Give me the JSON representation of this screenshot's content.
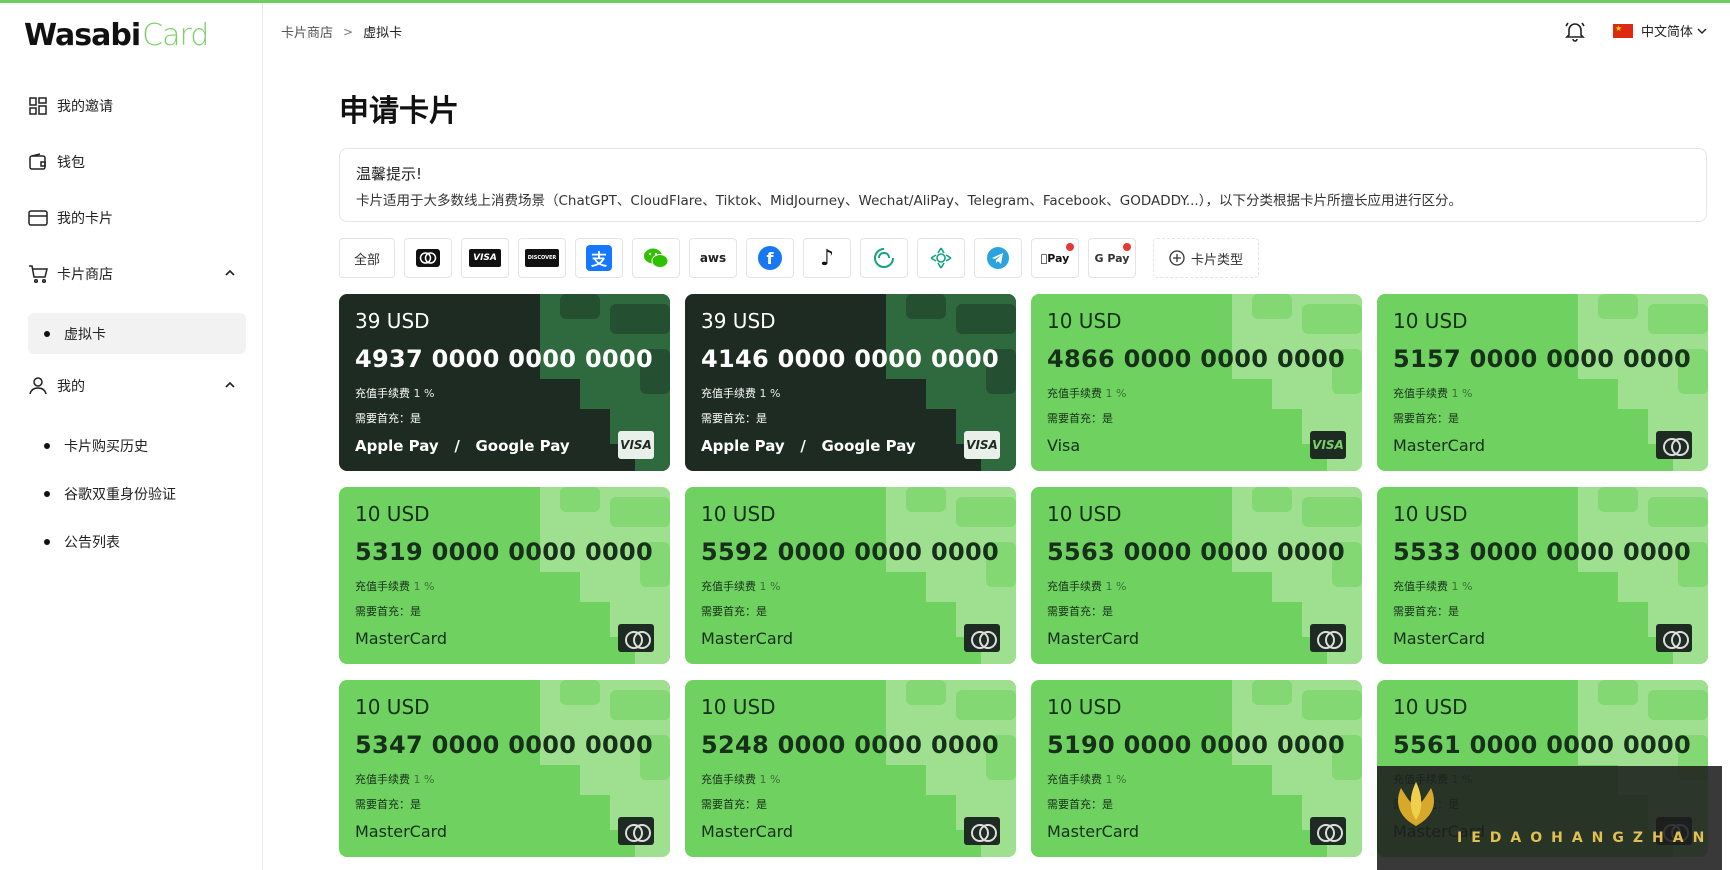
{
  "brand": {
    "part1": "Wasabi",
    "part2": "Card"
  },
  "sidebar": {
    "items": [
      {
        "label": "我的邀请",
        "icon": "grid-icon"
      },
      {
        "label": "钱包",
        "icon": "wallet-icon"
      },
      {
        "label": "我的卡片",
        "icon": "credit-card-icon"
      },
      {
        "label": "卡片商店",
        "icon": "cart-icon"
      },
      {
        "label": "我的",
        "icon": "user-icon"
      }
    ],
    "store_sub": [
      {
        "label": "虚拟卡"
      }
    ],
    "mine_sub": [
      {
        "label": "卡片购买历史"
      },
      {
        "label": "谷歌双重身份验证"
      },
      {
        "label": "公告列表"
      }
    ]
  },
  "header": {
    "breadcrumb": [
      "卡片商店",
      "虚拟卡"
    ],
    "breadcrumb_sep": ">",
    "language": "中文简体"
  },
  "page": {
    "title": "申请卡片",
    "notice_title": "温馨提示!",
    "notice_body": "卡片适用于大多数线上消费场景（ChatGPT、CloudFlare、Tiktok、MidJourney、Wechat/AliPay、Telegram、Facebook、GODADDY...），以下分类根据卡片所擅长应用进行区分。"
  },
  "filters": {
    "all": "全部",
    "chips": [
      {
        "name": "mastercard",
        "text": ""
      },
      {
        "name": "visa",
        "text": "VISA"
      },
      {
        "name": "discover",
        "text": "DISCOVER"
      },
      {
        "name": "alipay",
        "text": "支"
      },
      {
        "name": "wechat",
        "text": ""
      },
      {
        "name": "aws",
        "text": "aws"
      },
      {
        "name": "facebook",
        "text": "f"
      },
      {
        "name": "tiktok",
        "text": "♪"
      },
      {
        "name": "cloud",
        "text": ""
      },
      {
        "name": "openai",
        "text": ""
      },
      {
        "name": "telegram",
        "text": ""
      },
      {
        "name": "apple-pay",
        "text": "Pay"
      },
      {
        "name": "google-pay",
        "text": "G Pay"
      }
    ],
    "type_label": "卡片类型"
  },
  "cards": [
    {
      "amount": "39 USD",
      "number": "4937 0000 0000 0000",
      "fee_label": "充值手续费",
      "fee": "1 %",
      "req": "需要首充：是",
      "brand": "Apple Pay   /   Google Pay",
      "badge": "VISA",
      "style": "dark"
    },
    {
      "amount": "39 USD",
      "number": "4146 0000 0000 0000",
      "fee_label": "充值手续费",
      "fee": "1 %",
      "req": "需要首充：是",
      "brand": "Apple Pay   /   Google Pay",
      "badge": "VISA",
      "style": "dark"
    },
    {
      "amount": "10 USD",
      "number": "4866 0000 0000 0000",
      "fee_label": "充值手续费",
      "fee": "1 %",
      "req": "需要首充：是",
      "brand": "Visa",
      "badge": "VISA",
      "style": "green"
    },
    {
      "amount": "10 USD",
      "number": "5157 0000 0000 0000",
      "fee_label": "充值手续费",
      "fee": "1 %",
      "req": "需要首充：是",
      "brand": "MasterCard",
      "badge": "mc",
      "style": "green"
    },
    {
      "amount": "10 USD",
      "number": "5319 0000 0000 0000",
      "fee_label": "充值手续费",
      "fee": "1 %",
      "req": "需要首充：是",
      "brand": "MasterCard",
      "badge": "mc",
      "style": "green"
    },
    {
      "amount": "10 USD",
      "number": "5592 0000 0000 0000",
      "fee_label": "充值手续费",
      "fee": "1 %",
      "req": "需要首充：是",
      "brand": "MasterCard",
      "badge": "mc",
      "style": "green"
    },
    {
      "amount": "10 USD",
      "number": "5563 0000 0000 0000",
      "fee_label": "充值手续费",
      "fee": "1 %",
      "req": "需要首充：是",
      "brand": "MasterCard",
      "badge": "mc",
      "style": "green"
    },
    {
      "amount": "10 USD",
      "number": "5533 0000 0000 0000",
      "fee_label": "充值手续费",
      "fee": "1 %",
      "req": "需要首充：是",
      "brand": "MasterCard",
      "badge": "mc",
      "style": "green"
    },
    {
      "amount": "10 USD",
      "number": "5347 0000 0000 0000",
      "fee_label": "充值手续费",
      "fee": "1 %",
      "req": "需要首充：是",
      "brand": "MasterCard",
      "badge": "mc",
      "style": "green"
    },
    {
      "amount": "10 USD",
      "number": "5248 0000 0000 0000",
      "fee_label": "充值手续费",
      "fee": "1 %",
      "req": "需要首充：是",
      "brand": "MasterCard",
      "badge": "mc",
      "style": "green"
    },
    {
      "amount": "10 USD",
      "number": "5190 0000 0000 0000",
      "fee_label": "充值手续费",
      "fee": "1 %",
      "req": "需要首充：是",
      "brand": "MasterCard",
      "badge": "mc",
      "style": "green"
    },
    {
      "amount": "10 USD",
      "number": "5561 0000 0000 0000",
      "fee_label": "充值手续费",
      "fee": "1 %",
      "req": "需要首充：是",
      "brand": "MasterCard",
      "badge": "mc",
      "style": "green"
    }
  ],
  "watermark": {
    "text": "IEDAOHANGZHAN"
  },
  "colors": {
    "accent": "#6fd160",
    "dark_card": "#1d2b22"
  }
}
